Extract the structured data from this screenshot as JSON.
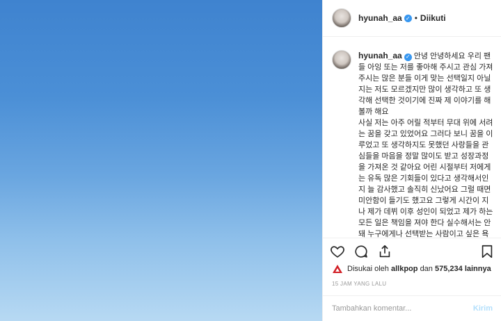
{
  "header": {
    "username": "hyunah_aa",
    "separator": "•",
    "follow_label": "Diikuti"
  },
  "caption": {
    "username": "hyunah_aa",
    "text": "안녕 안녕하세요 우리 팬들 아잉 또는 저를 좋아해 주시고 관심 가져주시는 많은 분들 이게 맞는 선택일지 아닐지는 저도 모르겠지만 많이 생각하고 또 생각해 선택한 것이기에 진짜 제 이야기를 해 볼까 해요\n사실 저는 아주 어릴 적부터 무대 위에 서려는 꿈을 갖고 있었어요 그러다 보니 꿈을 이루었고 또 생각하지도 못했던 사랑들을 관심들을 마음을 정말 많이도 받고 성장과정을 가져온 것 같아요 어린 시절부터 저에게는 유독 많은 기회들이 있다고 생각해서인지 늘 감사했고 솔직히 신났어요 그럴 때면 미안함이 들기도 했고요 그렇게 시간이 지나 제가 데뷔 이후 성인이 되었고 제가 하는 모든 일은 책임을 져야 한다 실수해서는 안 돼 누구에게나 선택받는 사람이고 싶은 욕심이 생겨 앞만 보고"
  },
  "likes": {
    "prefix": "Disukai oleh",
    "first_user": "allkpop",
    "connector": "dan",
    "count": "575,234",
    "suffix": "lainnya"
  },
  "time_ago": "15 JAM YANG LALU",
  "comment": {
    "placeholder": "Tambahkan komentar...",
    "post_label": "Kirim"
  },
  "colors": {
    "verified": "#3897f0",
    "post_disabled": "#b2dffc",
    "sky_top": "#3f83cf",
    "sky_bottom": "#b7d9f3"
  },
  "icons": [
    "heart-icon",
    "comment-icon",
    "share-icon",
    "bookmark-icon",
    "verified-icon",
    "allkpop-logo-icon"
  ]
}
